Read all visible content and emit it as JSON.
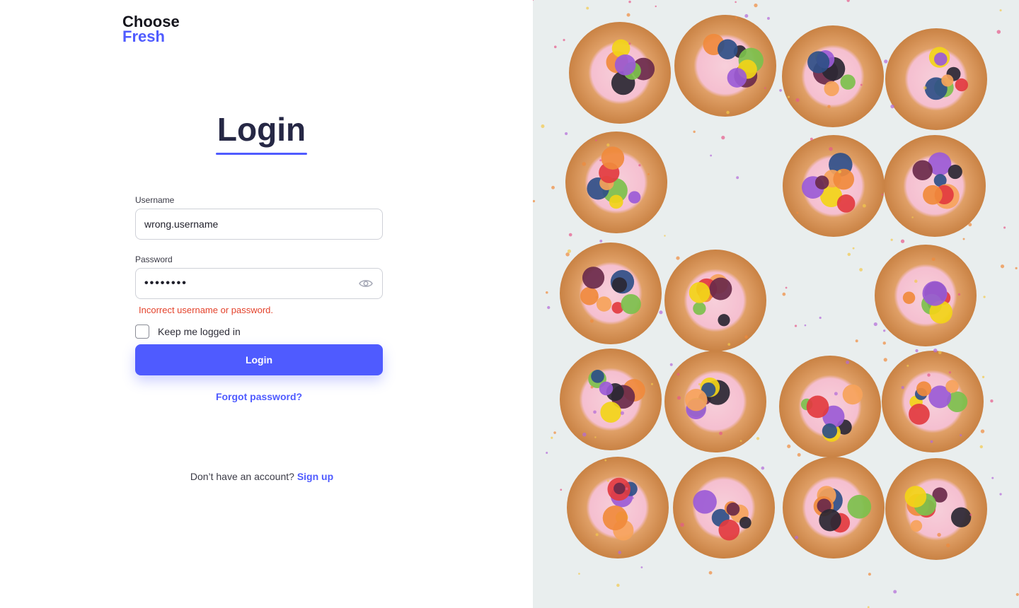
{
  "brand": {
    "line1": "Choose",
    "line2": "Fresh"
  },
  "page_title": "Login",
  "form": {
    "username_label": "Username",
    "username_value": "wrong.username",
    "password_label": "Password",
    "password_value": "••••••••",
    "error_message": "Incorrect username or password.",
    "keep_logged_in_label": "Keep me logged in",
    "keep_logged_in_checked": false,
    "login_button_label": "Login",
    "forgot_password_label": "Forgot password?"
  },
  "signup": {
    "prompt": "Don’t have an account?",
    "link_label": "Sign up"
  },
  "icons": {
    "password_toggle": "eye-icon"
  },
  "colors": {
    "accent": "#4f5bff",
    "error": "#e4432c",
    "title": "#262845"
  }
}
